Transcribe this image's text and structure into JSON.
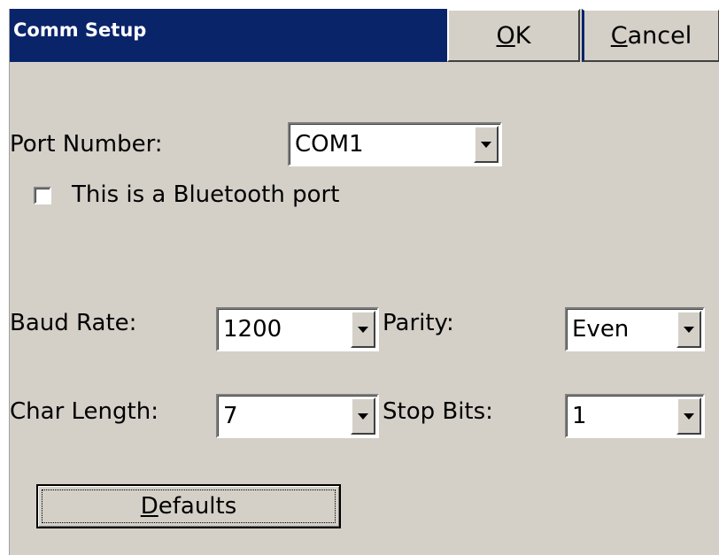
{
  "window": {
    "title": "Comm Setup",
    "ok_label": "OK",
    "cancel_label": "Cancel"
  },
  "port": {
    "label": "Port Number:",
    "value": "COM1"
  },
  "bluetooth": {
    "label": "This is a Bluetooth port",
    "checked": false
  },
  "baud": {
    "label": "Baud Rate:",
    "value": "1200"
  },
  "parity": {
    "label": "Parity:",
    "value": "Even"
  },
  "char_length": {
    "label": "Char Length:",
    "value": "7"
  },
  "stop_bits": {
    "label": "Stop Bits:",
    "value": "1"
  },
  "defaults_label": "Defaults",
  "colors": {
    "title_bar": "#0a246a",
    "title_text": "#ffffff",
    "dialog_bg": "#d4d0c8"
  },
  "icons": {
    "dropdown": "chevron-down-icon"
  }
}
